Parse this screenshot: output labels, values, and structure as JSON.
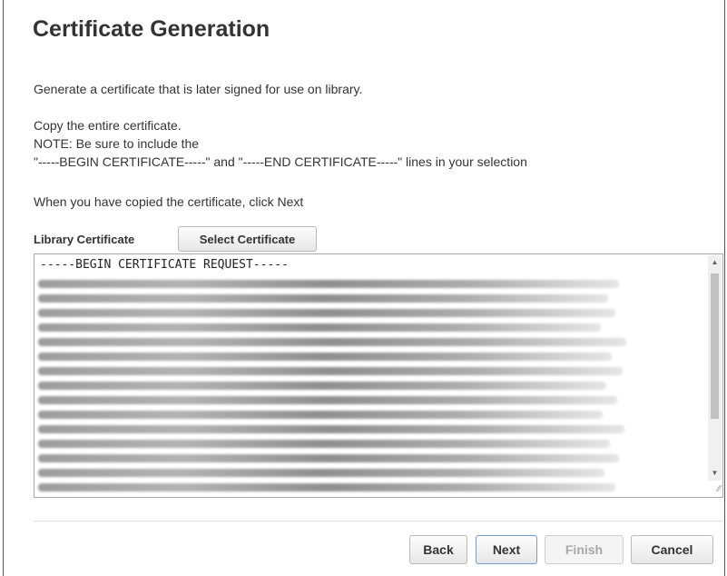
{
  "page": {
    "title": "Certificate Generation",
    "intro": "Generate a certificate that is later signed for use on library.",
    "copy_instruction_1": "Copy the entire certificate.",
    "copy_instruction_2": "NOTE: Be sure to include the",
    "copy_instruction_3": "\"-----BEGIN CERTIFICATE-----\" and \"-----END CERTIFICATE-----\" lines in your selection",
    "next_instruction": "When you have copied the certificate, click Next"
  },
  "certificate": {
    "label": "Library Certificate",
    "select_button": "Select Certificate",
    "first_line": "-----BEGIN CERTIFICATE REQUEST-----"
  },
  "footer": {
    "back": "Back",
    "next": "Next",
    "finish": "Finish",
    "cancel": "Cancel"
  },
  "icons": {
    "scroll_up": "scroll-up-arrow",
    "scroll_down": "scroll-down-arrow",
    "resize": "resize-grip"
  }
}
